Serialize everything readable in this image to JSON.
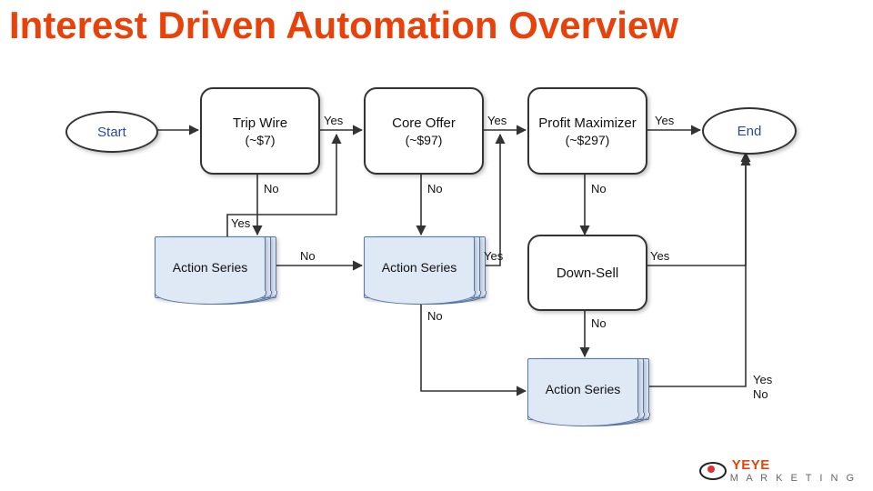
{
  "title": "Interest Driven Automation Overview",
  "nodes": {
    "start": "Start",
    "trip_wire": {
      "l1": "Trip Wire",
      "l2": "(~$7)"
    },
    "core_offer": {
      "l1": "Core Offer",
      "l2": "(~$97)"
    },
    "profit_max": {
      "l1": "Profit Maximizer",
      "l2": "(~$297)"
    },
    "end": "End",
    "action_series": "Action Series",
    "down_sell": "Down-Sell"
  },
  "labels": {
    "yes": "Yes",
    "no": "No"
  },
  "brand": {
    "name": "YEYE",
    "tag": "M A R K E T I N G"
  }
}
